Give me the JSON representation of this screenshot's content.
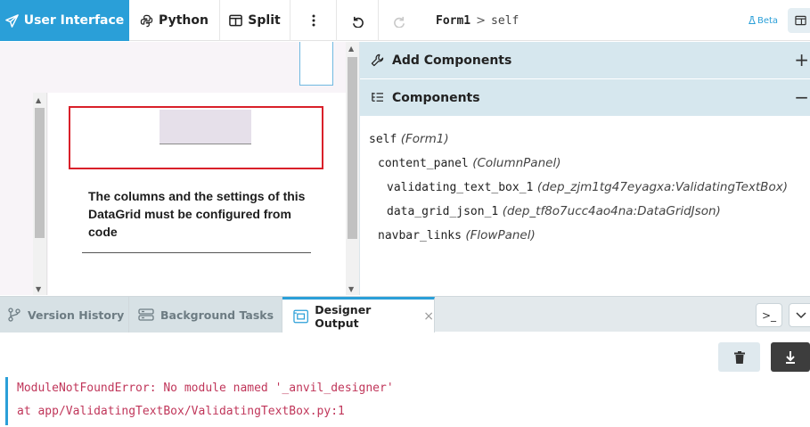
{
  "toolbar": {
    "ui_label": "User Interface",
    "python_label": "Python",
    "split_label": "Split",
    "more_icon": "more-vertical-icon",
    "undo_icon": "undo-icon",
    "redo_icon": "redo-icon"
  },
  "breadcrumb": {
    "form": "Form1",
    "separator": ">",
    "current": "self"
  },
  "beta_label": "Beta",
  "canvas": {
    "datagrid_message": "The columns and the settings of this DataGrid must be configured from code"
  },
  "panel": {
    "add_components": "Add Components",
    "add_toggle": "+",
    "components": "Components",
    "components_toggle": "−"
  },
  "tree": [
    {
      "name": "self",
      "type": "(Form1)"
    },
    {
      "name": "content_panel",
      "type": "(ColumnPanel)"
    },
    {
      "name": "validating_text_box_1",
      "type": "(dep_zjm1tg47eyagxa:ValidatingTextBox)"
    },
    {
      "name": "data_grid_json_1",
      "type": "(dep_tf8o7ucc4ao4na:DataGridJson)"
    },
    {
      "name": "navbar_links",
      "type": "(FlowPanel)"
    }
  ],
  "bottom_tabs": {
    "version_history": "Version History",
    "background_tasks": "Background Tasks",
    "designer_output": "Designer Output",
    "close": "×",
    "terminal": ">_"
  },
  "output": {
    "line1": "ModuleNotFoundError: No module named '_anvil_designer'",
    "line2": "at app/ValidatingTextBox/ValidatingTextBox.py:1"
  },
  "colors": {
    "accent": "#2a9fd8",
    "error_text": "#c0365a",
    "selection_border": "#d9202a"
  }
}
